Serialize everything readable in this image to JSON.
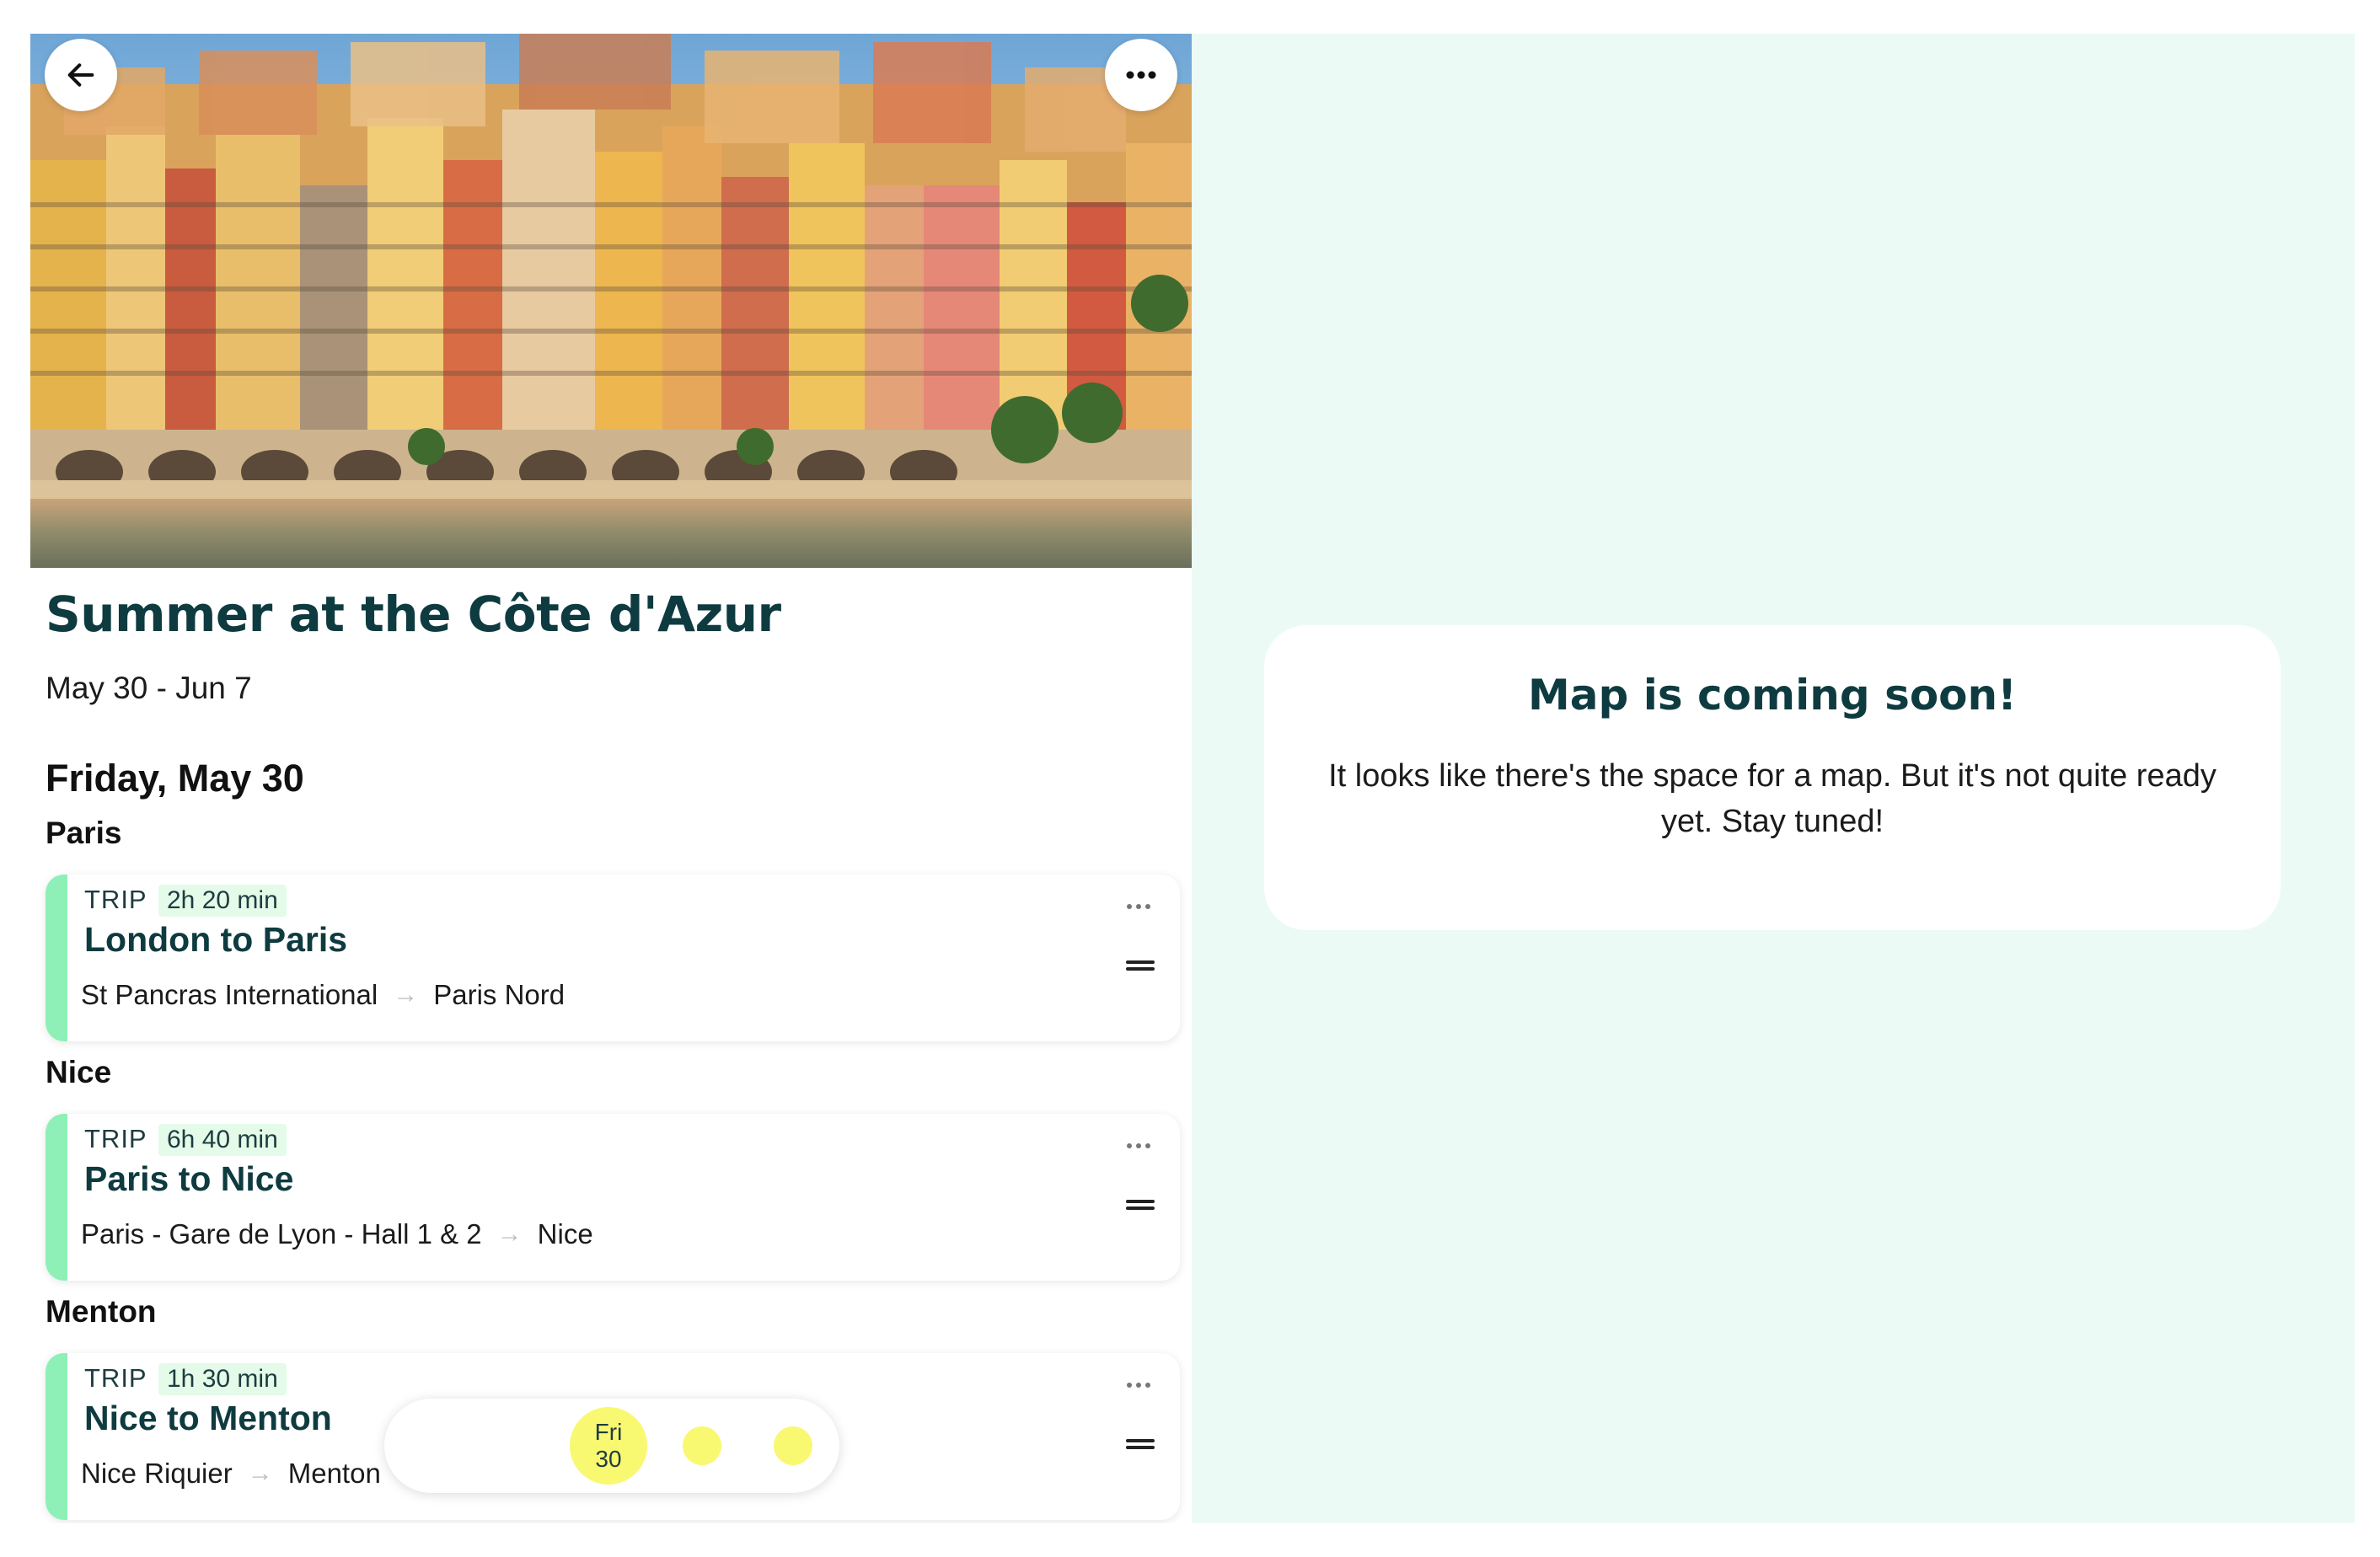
{
  "trip": {
    "title": "Summer at the Côte d'Azur",
    "dates": "May 30 - Jun 7"
  },
  "hero": {
    "image": "colorful seaside town buildings"
  },
  "buttons": {
    "back_icon": "arrow-left-icon",
    "more_icon": "more-horizontal-icon"
  },
  "itinerary": {
    "day_heading": "Friday, May 30",
    "sections": [
      {
        "city": "Paris",
        "card": {
          "type": "TRIP",
          "duration": "2h 20 min",
          "title": "London to Paris",
          "from": "St Pancras International",
          "to": "Paris Nord"
        }
      },
      {
        "city": "Nice",
        "card": {
          "type": "TRIP",
          "duration": "6h 40 min",
          "title": "Paris to Nice",
          "from": "Paris - Gare de Lyon - Hall 1 & 2",
          "to": "Nice"
        }
      },
      {
        "city": "Menton",
        "card": {
          "type": "TRIP",
          "duration": "1h 30 min",
          "title": "Nice to Menton",
          "from": "Nice Riquier",
          "to": "Menton"
        }
      }
    ]
  },
  "date_picker": {
    "active_day": "Fri",
    "active_date": "30",
    "dot_count": 2
  },
  "map": {
    "title": "Map is coming soon!",
    "text": "It looks like there's the space for a map. But it's not quite ready yet. Stay tuned!"
  },
  "colors": {
    "accent_green": "#8ef0b7",
    "dark_teal": "#0e3b40",
    "map_bg": "#ebfaf5",
    "date_yellow": "#f9f871"
  }
}
